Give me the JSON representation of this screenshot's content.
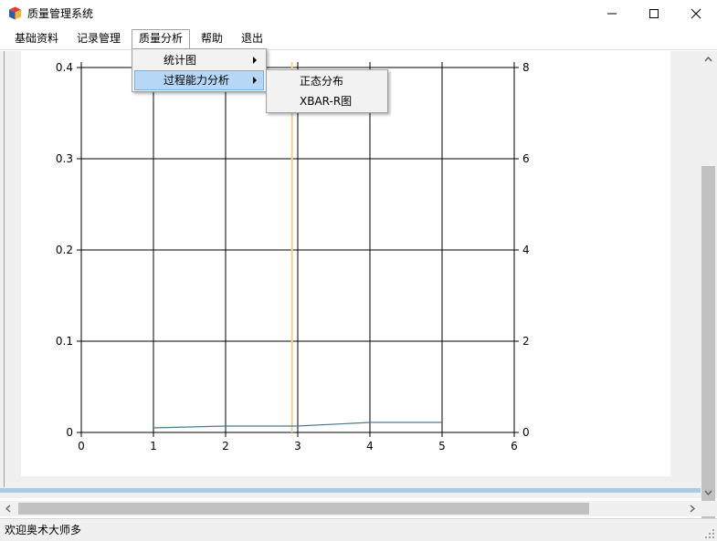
{
  "window": {
    "title": "质量管理系统"
  },
  "menubar": {
    "items": [
      {
        "label": "基础资料"
      },
      {
        "label": "记录管理"
      },
      {
        "label": "质量分析"
      },
      {
        "label": "帮助"
      },
      {
        "label": "退出"
      }
    ]
  },
  "quality_menu": {
    "items": [
      {
        "label": "统计图",
        "has_submenu": true
      },
      {
        "label": "过程能力分析",
        "has_submenu": true,
        "highlighted": true
      }
    ]
  },
  "capability_submenu": {
    "items": [
      {
        "label": "正态分布"
      },
      {
        "label": "XBAR-R图"
      }
    ]
  },
  "statusbar": {
    "text": "欢迎奥术大师多"
  },
  "colors": {
    "menu_highlight": "#b6d7f5",
    "series_line": "#4a7a96",
    "vertical_marker": "#f5d28c",
    "scroll_thumb": "#c1c1c1"
  },
  "chart_data": {
    "type": "line",
    "xlim": [
      0,
      6
    ],
    "ylim": [
      0,
      0.4
    ],
    "y2lim": [
      0,
      8
    ],
    "x_ticks": [
      "0",
      "1",
      "2",
      "3",
      "4",
      "5",
      "6"
    ],
    "y_ticks": [
      "0",
      "0.1",
      "0.2",
      "0.3",
      "0.4"
    ],
    "y2_ticks": [
      "0",
      "2",
      "4",
      "6",
      "8"
    ],
    "grid": true,
    "series": [
      {
        "x": [
          1,
          2,
          3,
          4,
          5
        ],
        "y": [
          0.005,
          0.007,
          0.007,
          0.011,
          0.011
        ]
      }
    ],
    "vertical_line_x": 2.92
  }
}
